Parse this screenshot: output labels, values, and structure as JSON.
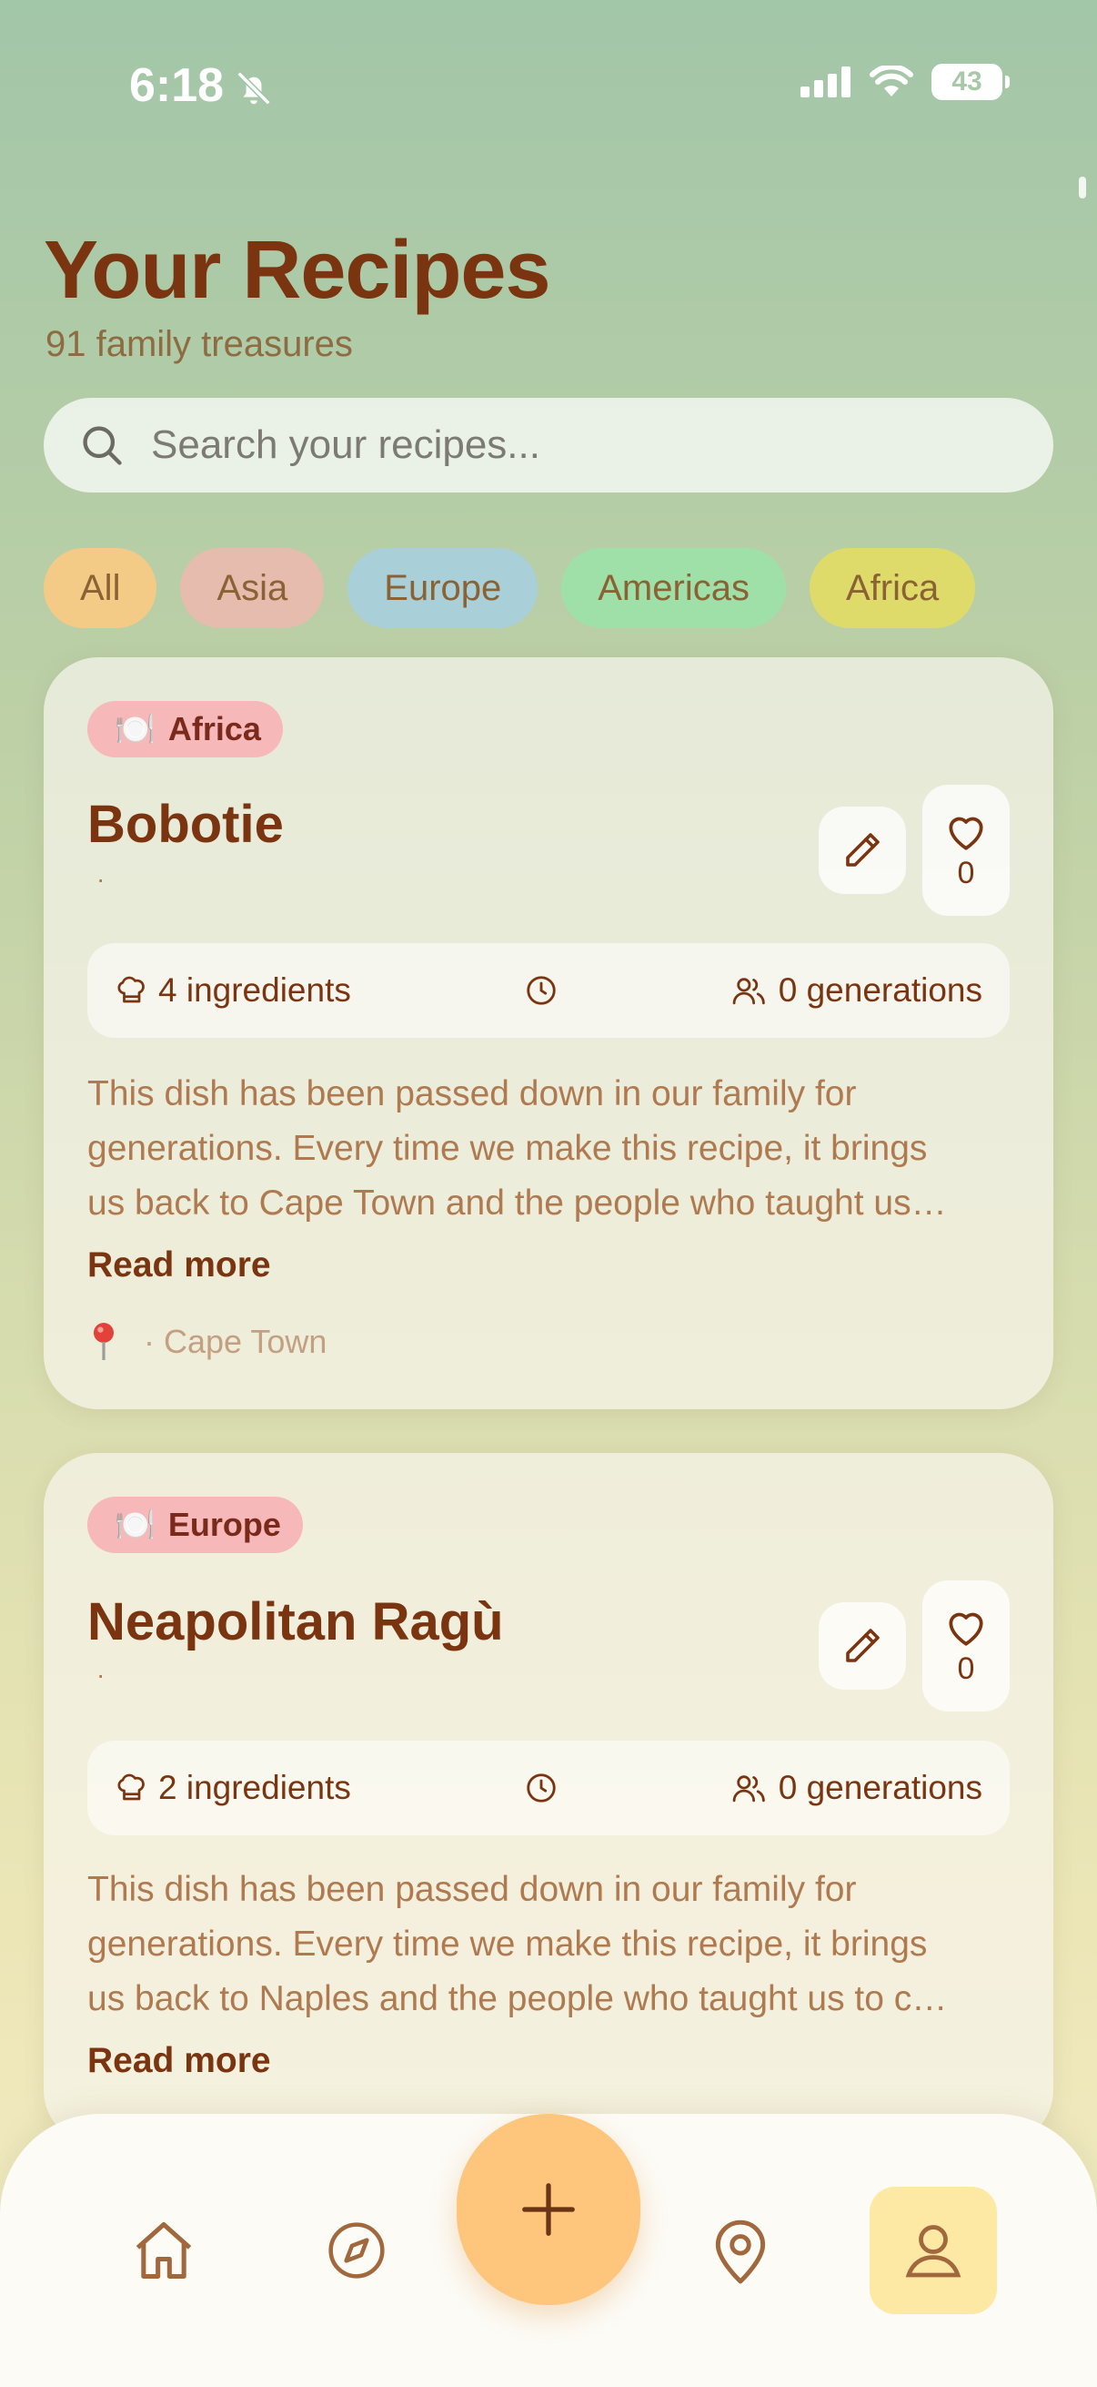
{
  "status_bar": {
    "time": "6:18",
    "battery": "43"
  },
  "header": {
    "title": "Your Recipes",
    "subtitle": "91 family treasures"
  },
  "search": {
    "placeholder": "Search your recipes..."
  },
  "filters": [
    {
      "label": "All",
      "color": "#f4cb86"
    },
    {
      "label": "Asia",
      "color": "#e6bcae"
    },
    {
      "label": "Europe",
      "color": "#a9cfd8"
    },
    {
      "label": "Americas",
      "color": "#9fe0a9"
    },
    {
      "label": "Africa",
      "color": "#dedb6a"
    }
  ],
  "recipes": [
    {
      "region": "Africa",
      "name": "Bobotie",
      "dot": "·",
      "likes": "0",
      "ingredients": "4 ingredients",
      "generations": "0 generations",
      "description_lines": [
        "This dish has been passed down in our family for",
        "generations. Every time we make this recipe, it brings",
        "us back to Cape Town and the people who taught us…"
      ],
      "read_more": "Read more",
      "location": "· Cape Town"
    },
    {
      "region": "Europe",
      "name": "Neapolitan Ragù",
      "dot": "·",
      "likes": "0",
      "ingredients": "2 ingredients",
      "generations": "0 generations",
      "description_lines": [
        "This dish has been passed down in our family for",
        "generations. Every time we make this recipe, it brings",
        "us back to Naples and the people who taught us to c…"
      ],
      "read_more": "Read more"
    }
  ],
  "bottom_nav": {
    "items": [
      "home-icon",
      "compass-icon",
      "plus-icon",
      "map-pin-icon",
      "user-icon"
    ],
    "active": "user-icon"
  },
  "colors": {
    "accent": "#fec67c",
    "title": "#7a3410",
    "badge": "#f6b8b8"
  }
}
